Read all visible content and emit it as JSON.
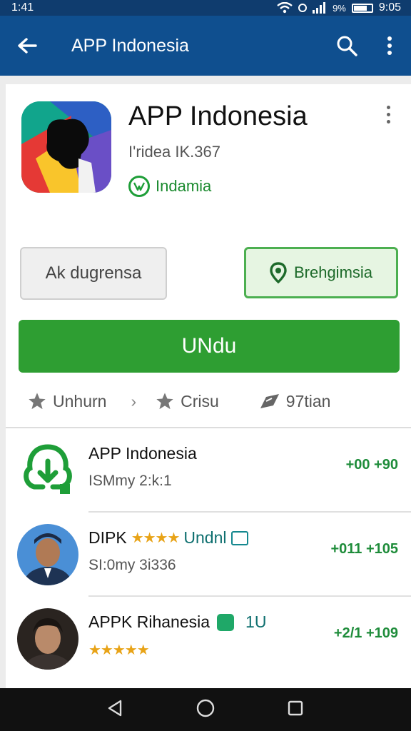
{
  "status_bar": {
    "time": "1:41",
    "battery": "9%",
    "clock": "9:05"
  },
  "app_bar": {
    "title": "APP Indonesia"
  },
  "app": {
    "name": "APP Indonesia",
    "developer": "I'ridea IK.367",
    "publisher": "Indamia"
  },
  "buttons": {
    "secondary": "Ak dugrensa",
    "location": "Brehgimsia",
    "install": "UNdu"
  },
  "meta": [
    {
      "label": "Unhurn",
      "icon": "star-icon"
    },
    {
      "label": "Crisu",
      "icon": "star-icon"
    },
    {
      "label": "97tian",
      "icon": "send-icon"
    }
  ],
  "list": [
    {
      "title": "APP Indonesia",
      "subtitle": "ISMmy 2:k:1",
      "value": "+00 +90"
    },
    {
      "title": "DIPK",
      "title_suffix": "Undnl",
      "stars": "★★★★",
      "subtitle": "SI:0my 3i336",
      "value": "+011 +105"
    },
    {
      "title": "APPK Rihanesia",
      "title_suffix": "1U",
      "stars": "★★★★★",
      "subtitle": "",
      "value": "+2/1 +109"
    }
  ],
  "colors": {
    "appbar": "#0f4f8f",
    "install": "#2e9e32",
    "accent_green": "#1e8c3a"
  }
}
